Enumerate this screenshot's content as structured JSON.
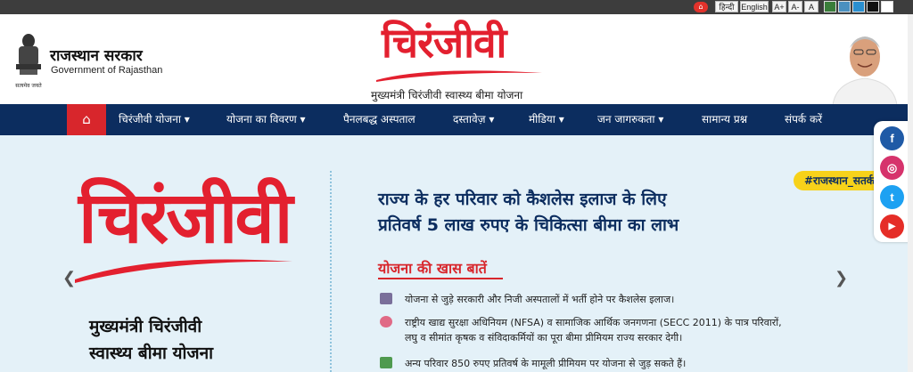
{
  "topbar": {
    "home_icon": "home-icon",
    "lang_hi": "हिन्दी",
    "lang_en": "English",
    "font_plus": "A+",
    "font_minus": "A-",
    "font_normal": "A",
    "theme_colors": [
      "#3a7d3a",
      "#4a90c0",
      "#2a8fd0",
      "#111111",
      "#ffffff"
    ]
  },
  "header": {
    "gov_hi": "राजस्थान सरकार",
    "gov_en": "Government of Rajasthan",
    "emblem_motto": "सत्यमेव जयते",
    "logo": "चिरंजीवी",
    "subtitle": "मुख्यमंत्री चिरंजीवी स्वास्थ्य बीमा योजना"
  },
  "nav": {
    "home_icon": "home-icon",
    "items": [
      {
        "label": "चिरंजीवी योजना",
        "dropdown": true
      },
      {
        "label": "योजना का विवरण",
        "dropdown": true
      },
      {
        "label": "पैनलबद्ध अस्पताल",
        "dropdown": false
      },
      {
        "label": "दस्तावेज़",
        "dropdown": true
      },
      {
        "label": "मीडिया",
        "dropdown": true
      },
      {
        "label": "जन जागरुकता",
        "dropdown": true
      },
      {
        "label": "सामान्य प्रश्न",
        "dropdown": false
      },
      {
        "label": "संपर्क करें",
        "dropdown": false
      }
    ]
  },
  "hero": {
    "logo": "चिरंजीवी",
    "subtitle_line1": "मुख्यमंत्री चिरंजीवी",
    "subtitle_line2": "स्वास्थ्य बीमा योजना",
    "headline_line1": "राज्य के हर परिवार को कैशलेस इलाज के लिए",
    "headline_line2": "प्रतिवर्ष 5 लाख रुपए के चिकित्सा बीमा का लाभ",
    "section_title": "योजना की खास बातें",
    "features": [
      {
        "icon": "hospital-icon",
        "text_lines": [
          "योजना से जुड़े सरकारी और निजी अस्पतालों में भर्ती होने पर कैशलेस इलाज।"
        ]
      },
      {
        "icon": "piggy-bank-icon",
        "text_lines": [
          "राष्ट्रीय खाद्य सुरक्षा अधिनियम (NFSA) व सामाजिक आर्थिक जनगणना (SECC 2011) के पात्र परिवारों,",
          "लघु व सीमांत कृषक व संविदाकर्मियों का पूरा बीमा प्रीमियम राज्य सरकार देगी।"
        ]
      },
      {
        "icon": "money-icon",
        "text_lines": [
          "अन्य परिवार 850 रुपए प्रतिवर्ष के मामूली प्रीमियम पर योजना से जुड़ सकते हैं।"
        ]
      }
    ],
    "hashtag": "#राजस्थान_सतर्क है",
    "prev_icon": "chevron-left-icon",
    "next_icon": "chevron-right-icon"
  },
  "social": {
    "items": [
      {
        "icon": "facebook-icon",
        "glyph": "f",
        "color": "#1f5aa6"
      },
      {
        "icon": "instagram-icon",
        "glyph": "◎",
        "color": "#d6336c"
      },
      {
        "icon": "twitter-icon",
        "glyph": "t",
        "color": "#1da1f2"
      },
      {
        "icon": "youtube-icon",
        "glyph": "▶",
        "color": "#e52d27"
      }
    ]
  },
  "colors": {
    "nav_bg": "#0c2d5f",
    "accent_red": "#d8262c",
    "hero_bg": "#e4f1f8",
    "hashtag_bg": "#f7d21a"
  }
}
